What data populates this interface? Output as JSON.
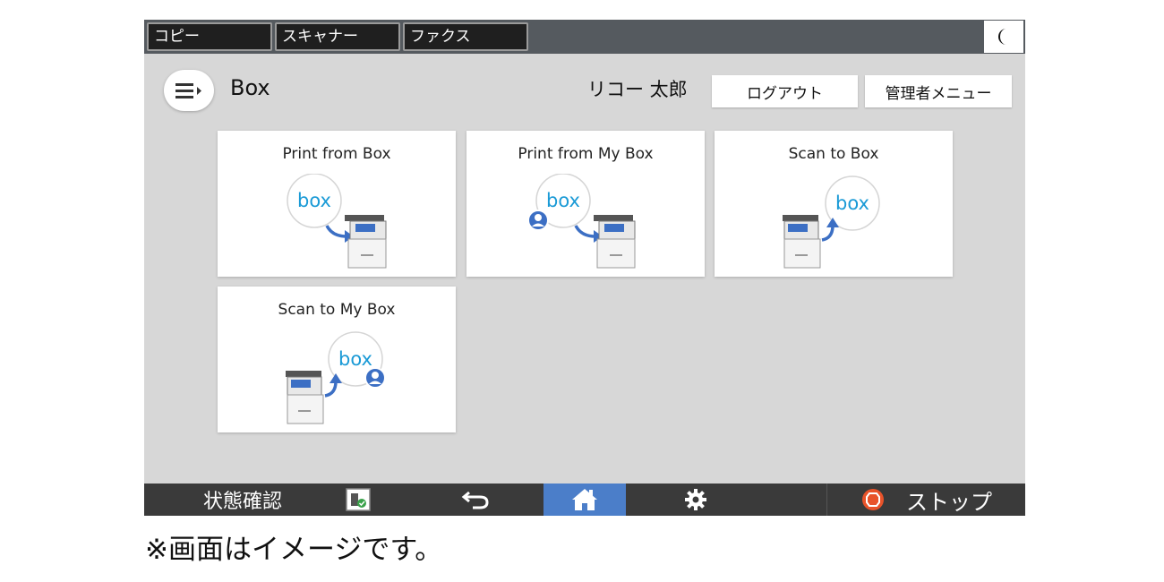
{
  "topbar": {
    "tabs": [
      {
        "label": "コピー"
      },
      {
        "label": "スキャナー"
      },
      {
        "label": "ファクス"
      }
    ],
    "night_icon": "crescent-moon-icon"
  },
  "header": {
    "menu_icon": "hamburger-menu-icon",
    "title": "Box",
    "user_name": "リコー 太郎",
    "logout_label": "ログアウト",
    "admin_label": "管理者メニュー"
  },
  "tiles": [
    {
      "label": "Print from Box",
      "icon": "box-to-printer-icon",
      "logo_text": "box"
    },
    {
      "label": "Print from My Box",
      "icon": "my-box-to-printer-icon",
      "logo_text": "box"
    },
    {
      "label": "Scan to Box",
      "icon": "printer-to-box-icon",
      "logo_text": "box"
    },
    {
      "label": "Scan to My Box",
      "icon": "printer-to-my-box-icon",
      "logo_text": "box"
    }
  ],
  "bottombar": {
    "status_label": "状態確認",
    "message_icon": "status-message-icon",
    "back_icon": "back-arrow-icon",
    "home_icon": "home-icon",
    "settings_icon": "gear-icon",
    "stop_icon": "stop-icon",
    "stop_label": "ストップ"
  },
  "caption": "※画面はイメージです。",
  "colors": {
    "screen_bg": "#d7d7d7",
    "topbar_bg": "#555a5f",
    "bottombar_bg": "#3a3a3a",
    "home_active": "#4b7ec9",
    "box_blue": "#1a9ad6",
    "arrow_blue": "#3c6fc4",
    "stop_orange": "#e8532a"
  }
}
